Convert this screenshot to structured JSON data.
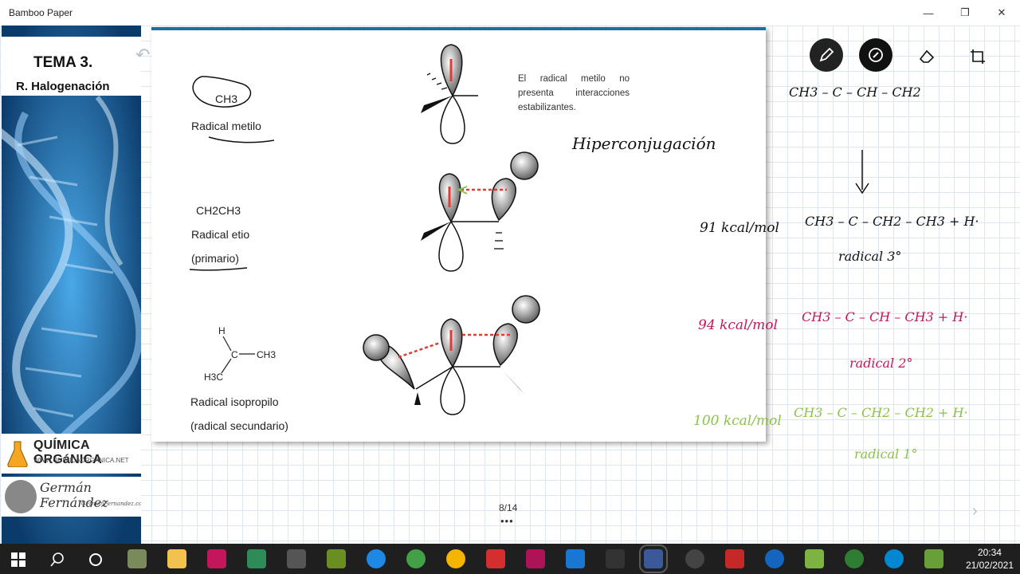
{
  "window": {
    "title": "Bamboo Paper"
  },
  "banner": {
    "tema_title": "TEMA 3.",
    "tema_subtitle": "R. Halogenación",
    "brand_title": "QUÍMICA ORGáNICA",
    "brand_url": "WWW.QUIMICAORGANICA.NET",
    "author_name": "Germán Fernández",
    "author_site": "GermanFernandez.com"
  },
  "slide": {
    "row1_formula": "CH3",
    "row1_label": "Radical metilo",
    "row2_formula": "CH2CH3",
    "row2_label": "Radical etio",
    "row2_sublabel": "(primario)",
    "row3_formula_right": "CH3",
    "row3_formula_left": "H3C",
    "row3_label": "Radical isopropilo",
    "row3_sublabel": "(radical secundario)",
    "description": "El radical metilo no presenta interacciones estabilizantes.",
    "atom_h": "H"
  },
  "pager": {
    "page": "8/14",
    "more": "•••"
  },
  "annotations": {
    "hyperconj": "Hiperconjugación",
    "kcal_91": "91 kcal/mol",
    "kcal_94": "94 kcal/mol",
    "kcal_100": "100 kcal/mol",
    "rad3_label": "radical 3°",
    "rad2_label": "radical 2°",
    "rad1_label": "radical 1°",
    "top_formula": "CH3 – C – CH – CH2",
    "f3": "CH3 – C – CH2 – CH3 + H·",
    "f2": "CH3 – C – CH – CH3 + H·",
    "f1": "CH3 – C – CH2 – CH2 + H·"
  },
  "taskbar": {
    "time": "20:34",
    "date": "21/02/2021"
  },
  "colors": {
    "accent": "#1b6fa6",
    "pink": "#c2185b",
    "green": "#8bc34a",
    "red": "#e53935"
  }
}
